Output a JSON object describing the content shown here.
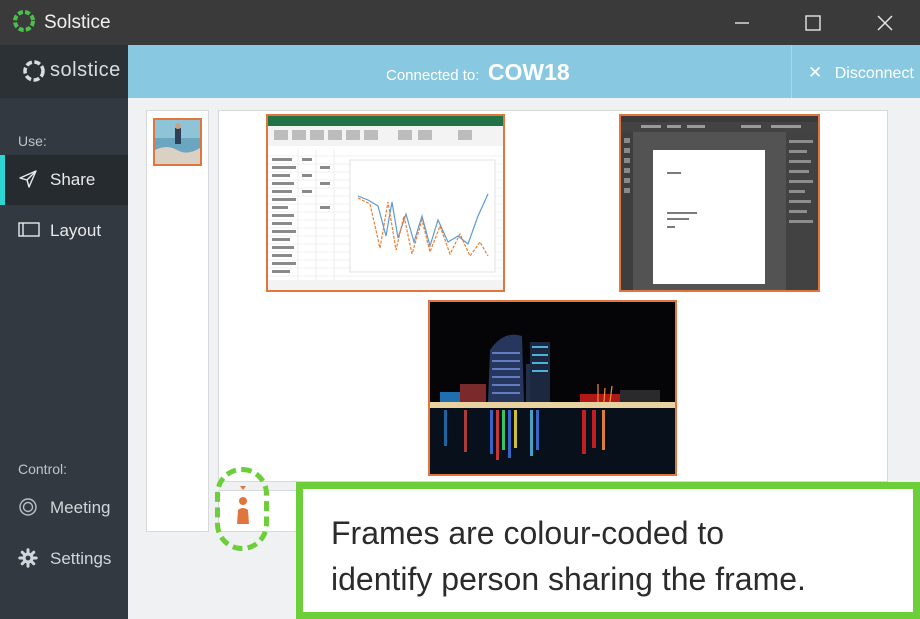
{
  "window": {
    "title": "Solstice",
    "controls": {
      "minimize": "minimize-icon",
      "maximize": "maximize-icon",
      "close": "close-icon"
    }
  },
  "sidebar": {
    "brand": "solstice",
    "use_label": "Use:",
    "use_items": [
      {
        "label": "Share",
        "icon": "send-icon",
        "active": true
      },
      {
        "label": "Layout",
        "icon": "layout-icon",
        "active": false
      }
    ],
    "control_label": "Control:",
    "control_items": [
      {
        "label": "Meeting",
        "icon": "meeting-icon"
      },
      {
        "label": "Settings",
        "icon": "gear-icon"
      }
    ]
  },
  "header": {
    "connected_label": "Connected to:",
    "room_name": "COW18",
    "disconnect_label": "Disconnect"
  },
  "canvas": {
    "frames": [
      {
        "name": "excel-spreadsheet-frame",
        "icon": "spreadsheet-icon"
      },
      {
        "name": "document-editor-frame",
        "icon": "document-icon"
      },
      {
        "name": "city-night-photo-frame",
        "icon": "photo-icon"
      }
    ],
    "frame_color": "#e0763e"
  },
  "callout": {
    "line1": "Frames are colour-coded to",
    "line2": "identify person sharing the frame."
  },
  "colors": {
    "accent": "#2bd6d3",
    "header_bar": "#88c9e1",
    "sidebar": "#333940",
    "highlight_green": "#6ccf3a",
    "frame_orange": "#e0763e"
  }
}
